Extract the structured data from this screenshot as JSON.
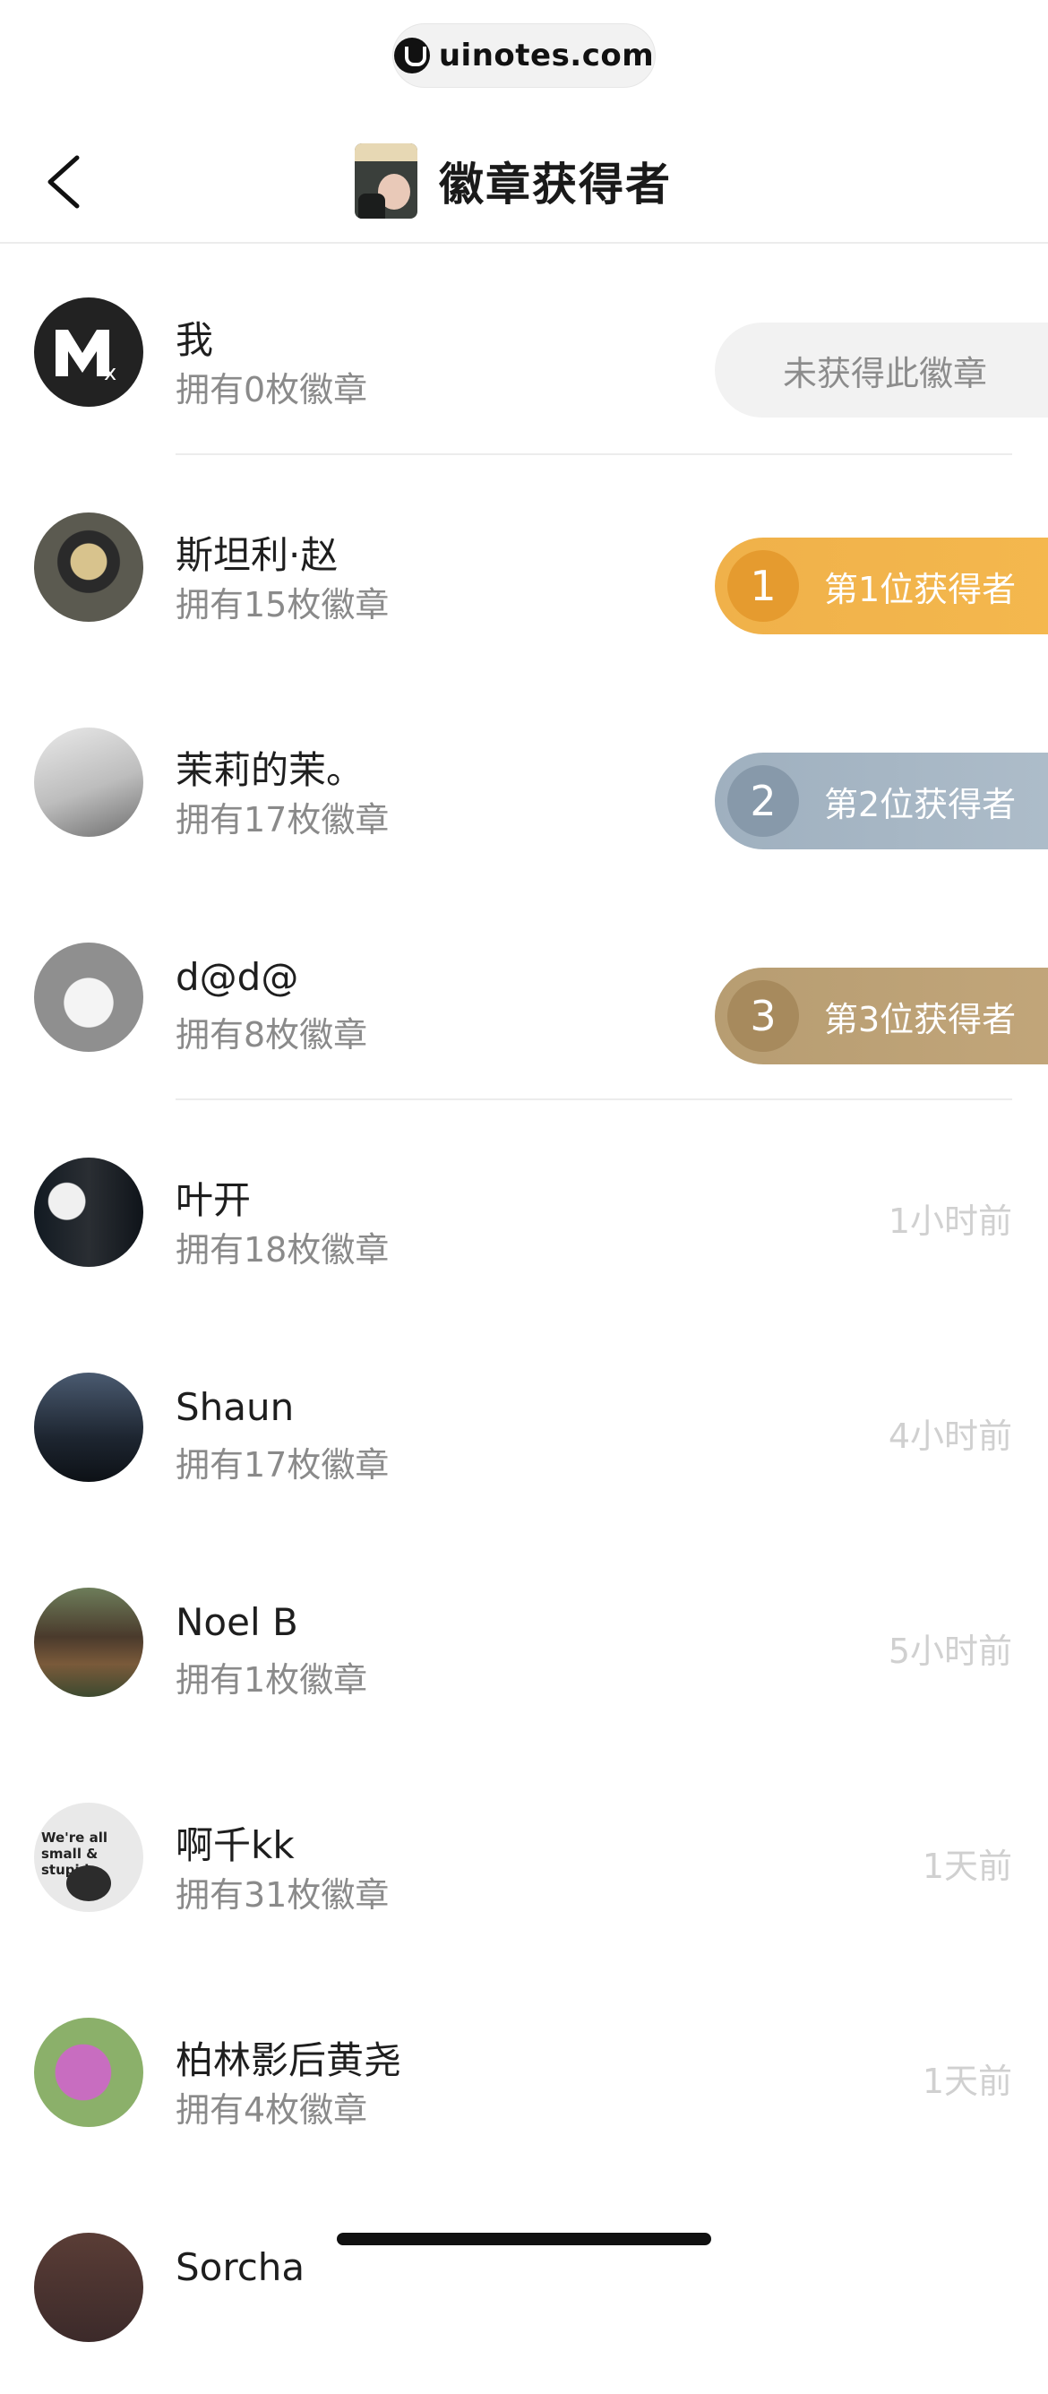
{
  "watermark": {
    "text": "uinotes.com"
  },
  "nav": {
    "title": "徽章获得者"
  },
  "me": {
    "name": "我",
    "count": "拥有0枚徽章",
    "status": "未获得此徽章"
  },
  "ranked": [
    {
      "name": "斯坦利·赵",
      "count": "拥有15枚徽章",
      "rank": "1",
      "label": "第1位获得者"
    },
    {
      "name": "茉莉的茉。",
      "count": "拥有17枚徽章",
      "rank": "2",
      "label": "第2位获得者"
    },
    {
      "name": "d@d@",
      "count": "拥有8枚徽章",
      "rank": "3",
      "label": "第3位获得者"
    }
  ],
  "others": [
    {
      "name": "叶开",
      "count": "拥有18枚徽章",
      "time": "1小时前"
    },
    {
      "name": "Shaun",
      "count": "拥有17枚徽章",
      "time": "4小时前"
    },
    {
      "name": "Noel B",
      "count": "拥有1枚徽章",
      "time": "5小时前"
    },
    {
      "name": "啊千kk",
      "count": "拥有31枚徽章",
      "time": "1天前"
    },
    {
      "name": "柏林影后黄尧",
      "count": "拥有4枚徽章",
      "time": "1天前"
    },
    {
      "name": "Sorcha",
      "count": "",
      "time": ""
    }
  ],
  "avatar_text": {
    "avatar_8": "We're all small & stupid."
  },
  "colors": {
    "rank1": "#f0b14a",
    "rank2": "#9fb0bf",
    "rank3": "#b79d72"
  }
}
